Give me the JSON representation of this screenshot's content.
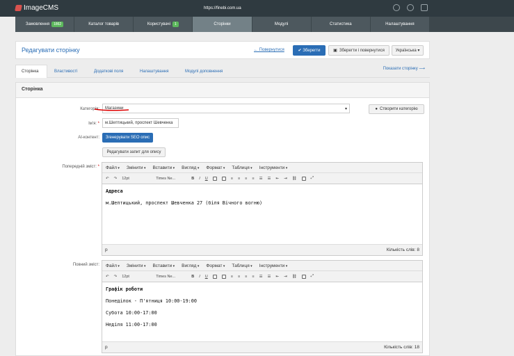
{
  "topbar": {
    "logo": "ImageCMS",
    "url": "https://finebi.com.ua"
  },
  "nav": {
    "items": [
      {
        "label": "Замовлення",
        "badge": "1862"
      },
      {
        "label": "Каталог товарів"
      },
      {
        "label": "Користувачі",
        "badge": "1"
      },
      {
        "label": "Сторінки"
      },
      {
        "label": "Модулі"
      },
      {
        "label": "Статистика"
      },
      {
        "label": "Налаштування"
      }
    ]
  },
  "header": {
    "title": "Редагувати сторінку",
    "back": "← Повернутися",
    "save": "✔ Зберегти",
    "save_return": "Зберегти і повернутися",
    "language": "Українська ▾"
  },
  "tabs": [
    "Сторінка",
    "Властивості",
    "Додаткові поля",
    "Налаштування",
    "Модулі доповнення"
  ],
  "show_page": "Показати сторінку ⟶",
  "panel": {
    "title": "Сторінка",
    "category_label": "Категорія:",
    "category_value": "Магазини",
    "create_category": "Створити категорію",
    "name_label": "Ім'я:",
    "name_value": "м.Шептицький, проспект Шевченка",
    "ai_label": "AI-контент:",
    "generate_seo": "Згенерувати SEO опис",
    "edit_prompt": "Редагувати запит для опису",
    "preview_label": "Попередній зміст:",
    "full_label": "Повний зміст:"
  },
  "editor": {
    "menus": [
      "Файл",
      "Змінити",
      "Вставити",
      "Вигляд",
      "Формат",
      "Таблиця",
      "Інструменти"
    ],
    "font_size": "12pt",
    "font_family": "Times Ne...",
    "path": "p"
  },
  "preview": {
    "lines": [
      "Адреса",
      "м.Шептицький, проспект Шевченка 27 (біля Вічного вогню)"
    ],
    "word_count": "Кількість слів: 8"
  },
  "full": {
    "lines": [
      "Графік роботи",
      "Понеділок - П'ятниця 10:00-19:00",
      "Субота 10:00-17:00",
      "Неділя 11:00-17:00"
    ],
    "word_count": "Кількість слів: 18"
  },
  "colors": {
    "accent": "#2a6db5",
    "topbar": "#2f3a40",
    "nav": "#4d585e",
    "nav_active": "#738187",
    "badge": "#5cb85c"
  }
}
